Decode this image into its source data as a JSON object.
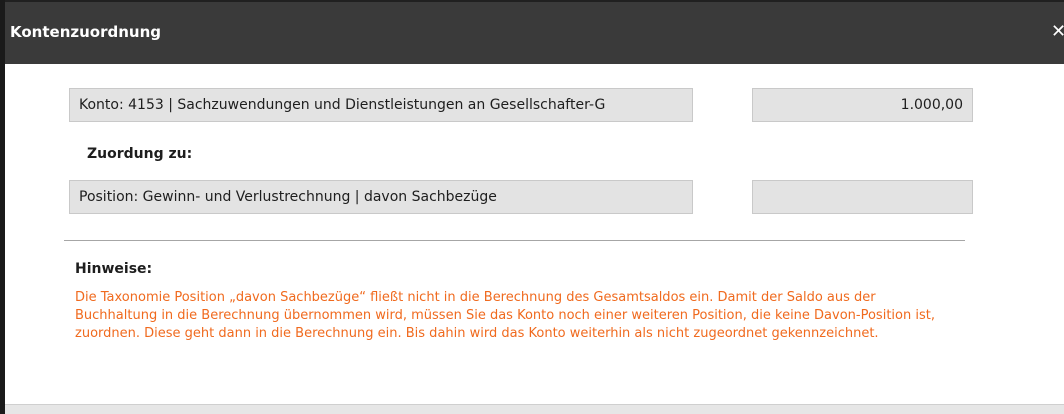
{
  "dialog": {
    "title": "Kontenzuordnung",
    "close_label": "✕"
  },
  "account": {
    "label": "Konto: 4153 | Sachzuwendungen und Dienstleistungen an Gesellschafter-G",
    "amount": "1.000,00"
  },
  "assignment": {
    "heading": "Zuordung zu:",
    "position_label": "Position: Gewinn- und Verlustrechnung | davon Sachbezüge",
    "position_amount": ""
  },
  "hints": {
    "heading": "Hinweise:",
    "text": "Die Taxonomie Position „davon Sachbezüge“ fließt nicht in die Berechnung des Gesamtsaldos ein. Damit der Saldo aus der Buchhaltung in die Berechnung übernommen wird, müssen Sie das Konto noch einer weiteren Position, die keine Davon-Position ist, zuordnen. Diese geht dann in die Berechnung ein. Bis dahin wird das Konto weiterhin als nicht zugeordnet gekennzeichnet."
  },
  "colors": {
    "titlebar": "#3a3a3a",
    "hint_text": "#f06a1e",
    "field_bg": "#e3e3e3"
  }
}
